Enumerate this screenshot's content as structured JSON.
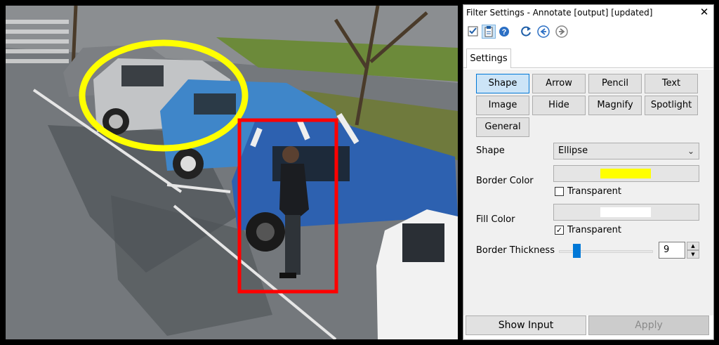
{
  "dialog": {
    "title": "Filter Settings - Annotate [output] [updated]",
    "close_glyph": "✕",
    "toolbar": [
      {
        "icon": "checkbox-view-icon"
      },
      {
        "icon": "clipboard-icon"
      },
      {
        "icon": "help-icon"
      },
      {
        "icon": "refresh-icon"
      },
      {
        "icon": "back-arrow-icon"
      },
      {
        "icon": "forward-arrow-icon"
      }
    ],
    "tab_label": "Settings",
    "filter_buttons": [
      "Shape",
      "Arrow",
      "Pencil",
      "Text",
      "Image",
      "Hide",
      "Magnify",
      "Spotlight",
      "General"
    ],
    "active_filter": "Shape",
    "shape_label": "Shape",
    "shape_value": "Ellipse",
    "border_color_label": "Border Color",
    "border_color": "#ffff00",
    "border_transparent_label": "Transparent",
    "border_transparent_checked": false,
    "fill_color_label": "Fill Color",
    "fill_color": "#ffffff",
    "fill_transparent_label": "Transparent",
    "fill_transparent_checked": true,
    "border_thickness_label": "Border Thickness",
    "border_thickness": "9",
    "show_input_label": "Show Input",
    "apply_label": "Apply"
  },
  "colors": {
    "ellipse_annotation": "#ffff00",
    "rect_annotation": "#ff0000",
    "accent": "#0078d7"
  }
}
